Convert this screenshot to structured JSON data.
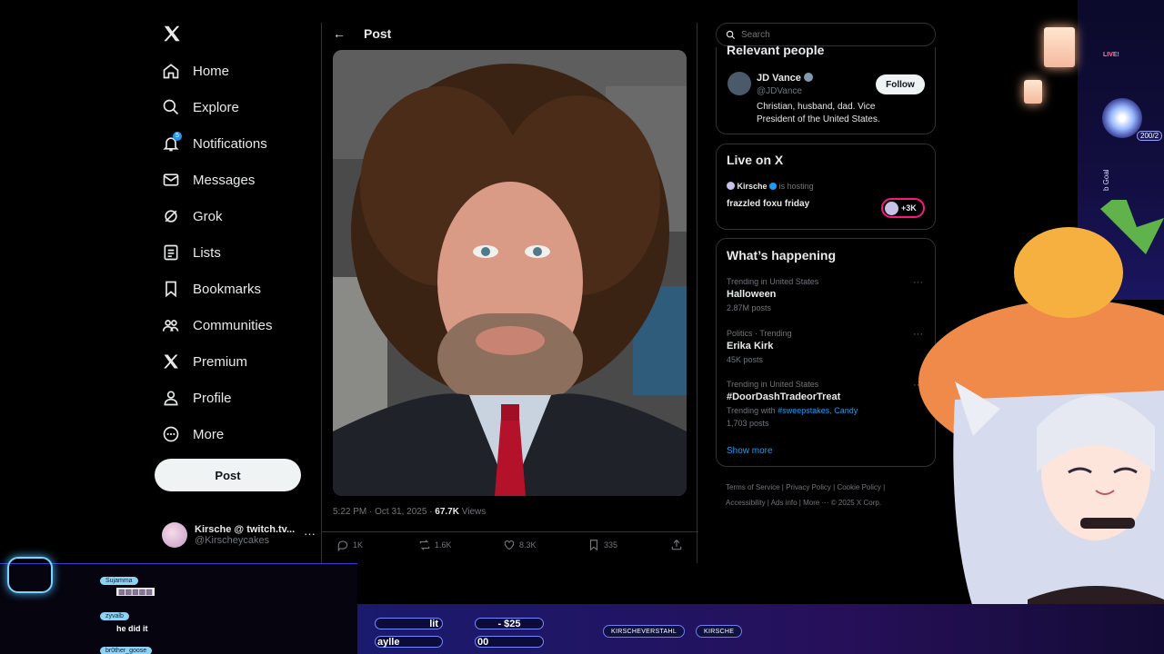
{
  "nav": {
    "items": [
      {
        "label": "Home",
        "icon": "home-icon"
      },
      {
        "label": "Explore",
        "icon": "search-icon"
      },
      {
        "label": "Notifications",
        "icon": "bell-icon"
      },
      {
        "label": "Messages",
        "icon": "mail-icon"
      },
      {
        "label": "Grok",
        "icon": "grok-icon"
      },
      {
        "label": "Lists",
        "icon": "list-icon"
      },
      {
        "label": "Bookmarks",
        "icon": "bookmark-icon"
      },
      {
        "label": "Communities",
        "icon": "people-icon"
      },
      {
        "label": "Premium",
        "icon": "x-logo-icon"
      },
      {
        "label": "Profile",
        "icon": "person-icon"
      },
      {
        "label": "More",
        "icon": "more-circle-icon"
      }
    ],
    "notification_count": "5",
    "post_button": "Post",
    "account": {
      "name": "Kirsche @ twitch.tv...",
      "handle": "@Kirscheycakes"
    }
  },
  "post": {
    "header_title": "Post",
    "time": "5:22 PM · Oct 31, 2025 · ",
    "views_count": "67.7K",
    "views_label": " Views",
    "replies": "1K",
    "reposts": "1.6K",
    "likes": "8.3K",
    "bookmarks": "335"
  },
  "search": {
    "placeholder": "Search"
  },
  "relevant_people": {
    "heading": "Relevant people",
    "name": "JD Vance",
    "handle": "@JDVance",
    "bio": "Christian, husband, dad. Vice President of the United States.",
    "follow_label": "Follow"
  },
  "live": {
    "heading": "Live on X",
    "host": "Kirsche",
    "hosting_text": "is hosting",
    "title": "frazzled foxu friday",
    "listeners": "+3K"
  },
  "happening": {
    "heading": "What’s happening",
    "trends": [
      {
        "context": "Trending in United States",
        "title": "Halloween",
        "count": "2.87M posts"
      },
      {
        "context": "Politics · Trending",
        "title": "Erika Kirk",
        "count": "45K posts"
      },
      {
        "context": "Trending in United States",
        "title": "#DoorDashTradeorTreat",
        "with_prefix": "Trending with ",
        "with_links": "#sweepstakes, Candy",
        "count": "1,703 posts"
      }
    ],
    "show_more": "Show more"
  },
  "footer": {
    "links": [
      "Terms of Service",
      "Privacy Policy",
      "Cookie Policy",
      "Accessibility",
      "Ads info",
      "More ···"
    ],
    "copyright": "© 2025 X Corp."
  },
  "overlay": {
    "chat": [
      {
        "user": "Sujamma",
        "msg": "▩▩▩▩▩"
      },
      {
        "user": "zyvalb",
        "msg": "he did it"
      },
      {
        "user": "br0ther_goose",
        "msg": ""
      }
    ],
    "bar_texts": [
      "lit",
      "- $25",
      "aylle",
      "00"
    ],
    "tags": [
      "KIRSCHEVERSTAHL",
      "KIRSCHE"
    ],
    "live_text": "LIVE!",
    "counter": "200/2",
    "goal_text": "b Goal"
  },
  "colors": {
    "accent": "#1d9bf0",
    "background": "#000000",
    "border": "#2f3336",
    "muted": "#71767b"
  }
}
